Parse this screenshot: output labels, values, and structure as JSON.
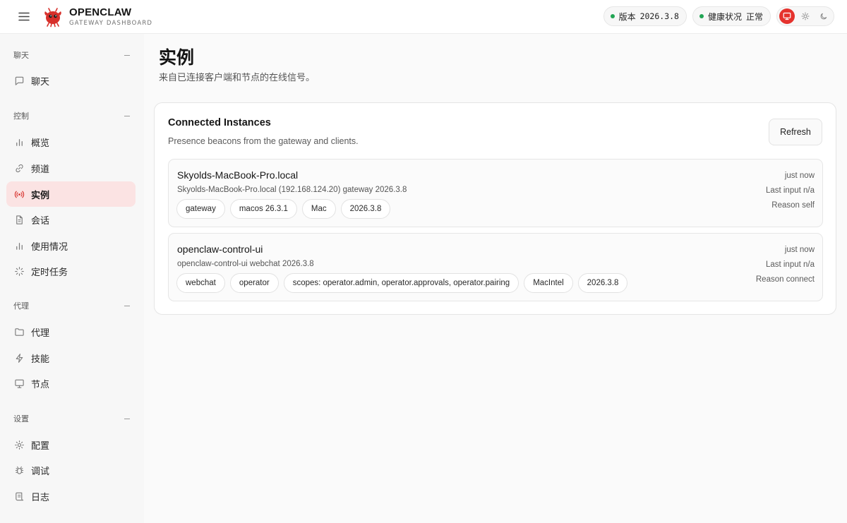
{
  "header": {
    "brand_title": "OPENCLAW",
    "brand_subtitle": "GATEWAY DASHBOARD",
    "version_label": "版本",
    "version_value": "2026.3.8",
    "health_label": "健康状况",
    "health_value": "正常",
    "accent_color": "#e5322d",
    "status_color": "#22a554"
  },
  "sidebar": {
    "sections": [
      {
        "label": "聊天",
        "items": [
          {
            "label": "聊天",
            "icon": "message-square-icon"
          }
        ]
      },
      {
        "label": "控制",
        "items": [
          {
            "label": "概览",
            "icon": "bar-chart-icon"
          },
          {
            "label": "频道",
            "icon": "link-icon"
          },
          {
            "label": "实例",
            "icon": "radio-icon",
            "active": true
          },
          {
            "label": "会话",
            "icon": "file-text-icon"
          },
          {
            "label": "使用情况",
            "icon": "bar-chart-icon"
          },
          {
            "label": "定时任务",
            "icon": "loader-icon"
          }
        ]
      },
      {
        "label": "代理",
        "items": [
          {
            "label": "代理",
            "icon": "folder-icon"
          },
          {
            "label": "技能",
            "icon": "zap-icon"
          },
          {
            "label": "节点",
            "icon": "monitor-icon"
          }
        ]
      },
      {
        "label": "设置",
        "items": [
          {
            "label": "配置",
            "icon": "settings-icon"
          },
          {
            "label": "调试",
            "icon": "bug-icon"
          },
          {
            "label": "日志",
            "icon": "scroll-icon"
          }
        ]
      }
    ]
  },
  "main": {
    "title": "实例",
    "subtitle": "来自已连接客户端和节点的在线信号。",
    "card": {
      "title": "Connected Instances",
      "subtitle": "Presence beacons from the gateway and clients.",
      "refresh_label": "Refresh",
      "instances": [
        {
          "name": "Skyolds-MacBook-Pro.local",
          "detail": "Skyolds-MacBook-Pro.local (192.168.124.20) gateway 2026.3.8",
          "chips": [
            "gateway",
            "macos 26.3.1",
            "Mac",
            "2026.3.8"
          ],
          "time": "just now",
          "last_input": "Last input n/a",
          "reason": "Reason self"
        },
        {
          "name": "openclaw-control-ui",
          "detail": "openclaw-control-ui webchat 2026.3.8",
          "chips": [
            "webchat",
            "operator",
            "scopes: operator.admin, operator.approvals, operator.pairing",
            "MacIntel",
            "2026.3.8"
          ],
          "time": "just now",
          "last_input": "Last input n/a",
          "reason": "Reason connect"
        }
      ]
    }
  }
}
